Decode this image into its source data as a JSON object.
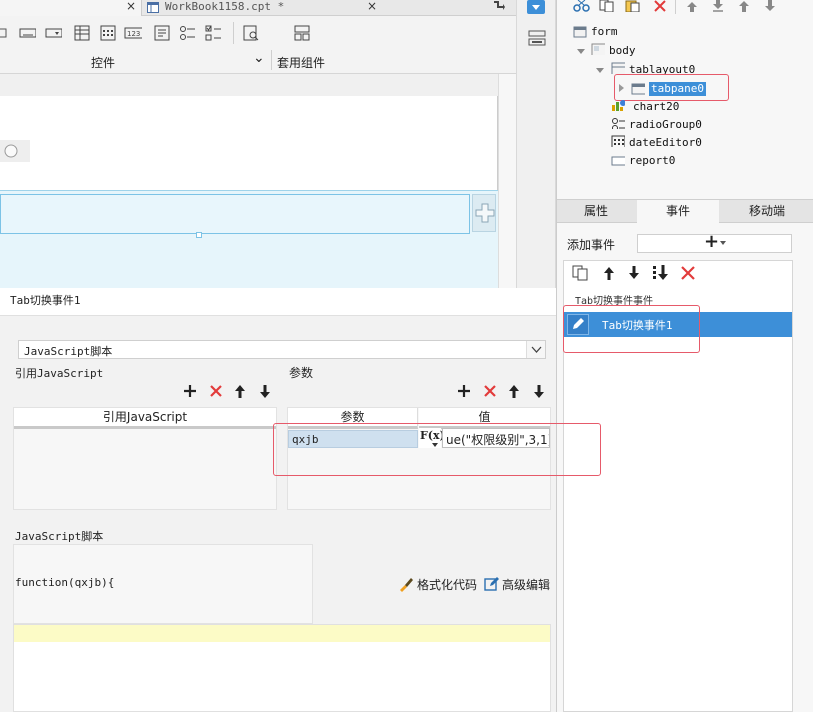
{
  "editor": {
    "tabs": [
      {
        "label": "",
        "close": "×"
      },
      {
        "label": "WorkBook1158.cpt *",
        "close": "×"
      }
    ],
    "toolbar": {
      "group_controls": "控件",
      "group_components": "套用组件",
      "expand_glyph": "⌄"
    }
  },
  "right_panel": {
    "tree": [
      {
        "label": "form"
      },
      {
        "label": "body"
      },
      {
        "label": "tablayout0"
      },
      {
        "label": "tabpane0"
      },
      {
        "label": "chart20"
      },
      {
        "label": "radioGroup0"
      },
      {
        "label": "dateEditor0"
      },
      {
        "label": "report0"
      }
    ],
    "tabs": {
      "attr": "属性",
      "event": "事件",
      "mobile": "移动端"
    },
    "add_event_label": "添加事件",
    "add_event_glyph": "+",
    "event_group_label": "Tab切换事件事件",
    "event_item_label": "Tab切换事件1"
  },
  "dialog": {
    "title": "Tab切换事件1",
    "script_type": "JavaScript脚本",
    "ref_js_label": "引用JavaScript",
    "params_label": "参数",
    "ref_js_col": "引用JavaScript",
    "param_col": "参数",
    "value_col": "值",
    "param_name": "qxjb",
    "param_value": "ue(\"权限级别\",3,1)",
    "fx_label": "F(x)",
    "script_section_label": "JavaScript脚本",
    "function_sig": "function(qxjb){",
    "format_code": "格式化代码",
    "advanced_edit": "高级编辑"
  }
}
